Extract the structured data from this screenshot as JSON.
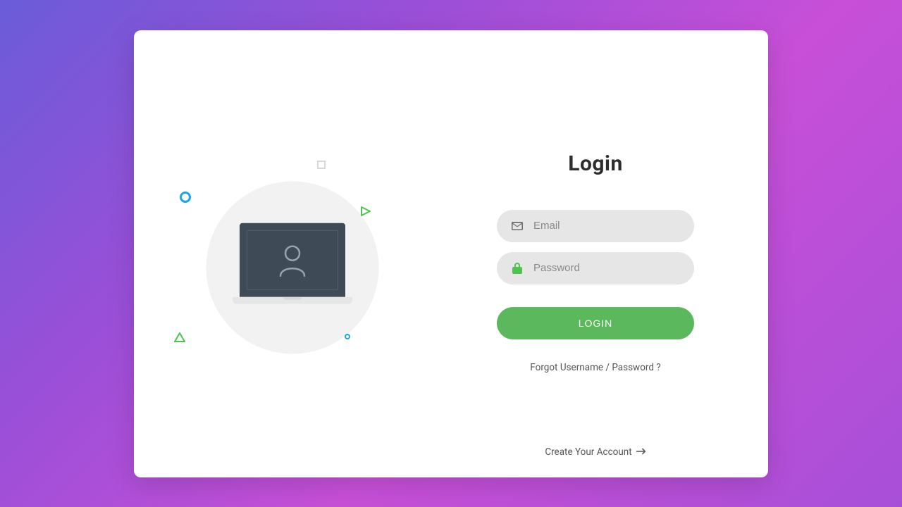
{
  "title": "Login",
  "email": {
    "placeholder": "Email",
    "value": ""
  },
  "password": {
    "placeholder": "Password",
    "value": ""
  },
  "login_button": "LOGIN",
  "forgot_link": "Forgot Username / Password ?",
  "create_link": "Create Your Account",
  "colors": {
    "accent_green": "#5cb85c",
    "field_bg": "#e6e6e6",
    "text": "#2e2e2e"
  },
  "icons": {
    "email": "envelope-icon",
    "password": "lock-icon",
    "create_arrow": "arrow-right-icon",
    "illustration_user": "user-icon"
  }
}
